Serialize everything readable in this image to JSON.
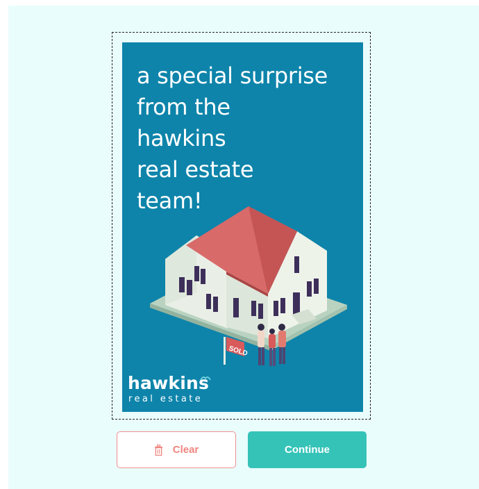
{
  "card": {
    "headline_lines": [
      "a special surprise",
      "from the",
      "hawkins",
      "real estate",
      "team!"
    ],
    "sign_text": "SOLD",
    "logo": {
      "name": "hawkins",
      "tagline": "real estate"
    }
  },
  "actions": {
    "clear_label": "Clear",
    "continue_label": "Continue"
  },
  "colors": {
    "card_background": "#0e84aa",
    "clear_accent": "#f0857f",
    "continue_background": "#35c3b8",
    "panel_background": "#eafdfd"
  },
  "icons": [
    "trash-icon",
    "bird-icon"
  ]
}
